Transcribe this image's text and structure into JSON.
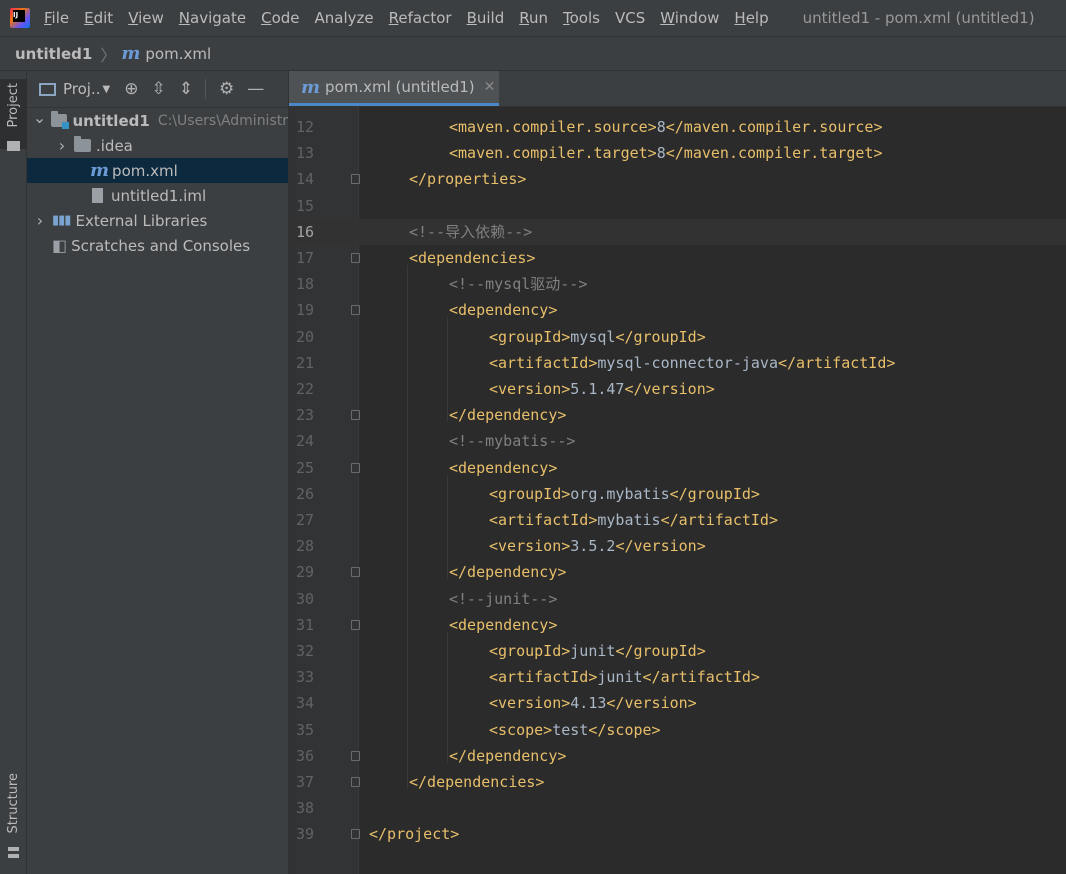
{
  "menubar": {
    "items": [
      {
        "label": "File",
        "u": "F",
        "rest": "ile"
      },
      {
        "label": "Edit",
        "u": "E",
        "rest": "dit"
      },
      {
        "label": "View",
        "u": "V",
        "rest": "iew"
      },
      {
        "label": "Navigate",
        "u": "N",
        "rest": "avigate"
      },
      {
        "label": "Code",
        "u": "C",
        "rest": "ode"
      },
      {
        "label": "Analyze",
        "u": "",
        "rest": "Analyze"
      },
      {
        "label": "Refactor",
        "u": "R",
        "rest": "efactor"
      },
      {
        "label": "Build",
        "u": "B",
        "rest": "uild"
      },
      {
        "label": "Run",
        "u": "R",
        "rest": "un"
      },
      {
        "label": "Tools",
        "u": "T",
        "rest": "ools"
      },
      {
        "label": "VCS",
        "u": "",
        "rest": "VCS"
      },
      {
        "label": "Window",
        "u": "W",
        "rest": "indow"
      },
      {
        "label": "Help",
        "u": "H",
        "rest": "elp"
      }
    ],
    "window_title": "untitled1 - pom.xml (untitled1)"
  },
  "navbar": {
    "project": "untitled1",
    "file": "pom.xml",
    "file_icon": "m"
  },
  "left_stripe": {
    "project_tab": "Project",
    "structure_tab": "Structure"
  },
  "project_panel": {
    "view_selector": "Proj..",
    "tree": [
      {
        "label": "untitled1",
        "path": "C:\\Users\\Administr",
        "level": 0,
        "arrow": "open",
        "icon": "module-folder",
        "bold": true
      },
      {
        "label": ".idea",
        "level": 1,
        "arrow": "closed",
        "icon": "folder"
      },
      {
        "label": "pom.xml",
        "level": 1,
        "arrow": "none",
        "icon": "maven",
        "selected": true
      },
      {
        "label": "untitled1.iml",
        "level": 1,
        "arrow": "none",
        "icon": "iml-file"
      },
      {
        "label": "External Libraries",
        "level": 0,
        "arrow": "closed",
        "icon": "libraries"
      },
      {
        "label": "Scratches and Consoles",
        "level": 0,
        "arrow": "none",
        "icon": "scratches"
      }
    ]
  },
  "editor": {
    "tab_label": "pom.xml (untitled1)",
    "current_line": 16,
    "lines": [
      {
        "n": "12",
        "indent": 2,
        "parts": [
          [
            "tag",
            "<maven.compiler.source>"
          ],
          [
            "txt",
            "8"
          ],
          [
            "tag",
            "</maven.compiler.source>"
          ]
        ]
      },
      {
        "n": "13",
        "indent": 2,
        "parts": [
          [
            "tag",
            "<maven.compiler.target>"
          ],
          [
            "txt",
            "8"
          ],
          [
            "tag",
            "</maven.compiler.target>"
          ]
        ]
      },
      {
        "n": "14",
        "indent": 1,
        "fold": true,
        "parts": [
          [
            "tag",
            "</properties>"
          ]
        ]
      },
      {
        "n": "15",
        "indent": 0,
        "parts": []
      },
      {
        "n": "16",
        "indent": 1,
        "parts": [
          [
            "cmt",
            "<!--导入依赖-->"
          ]
        ]
      },
      {
        "n": "17",
        "indent": 1,
        "fold": true,
        "parts": [
          [
            "tag",
            "<dependencies>"
          ]
        ]
      },
      {
        "n": "18",
        "indent": 2,
        "parts": [
          [
            "cmt",
            "<!--mysql驱动-->"
          ]
        ]
      },
      {
        "n": "19",
        "indent": 2,
        "fold": true,
        "parts": [
          [
            "tag",
            "<dependency>"
          ]
        ]
      },
      {
        "n": "20",
        "indent": 3,
        "parts": [
          [
            "tag",
            "<groupId>"
          ],
          [
            "txt",
            "mysql"
          ],
          [
            "tag",
            "</groupId>"
          ]
        ]
      },
      {
        "n": "21",
        "indent": 3,
        "parts": [
          [
            "tag",
            "<artifactId>"
          ],
          [
            "txt",
            "mysql-connector-java"
          ],
          [
            "tag",
            "</artifactId>"
          ]
        ]
      },
      {
        "n": "22",
        "indent": 3,
        "parts": [
          [
            "tag",
            "<version>"
          ],
          [
            "txt",
            "5.1.47"
          ],
          [
            "tag",
            "</version>"
          ]
        ]
      },
      {
        "n": "23",
        "indent": 2,
        "fold": true,
        "parts": [
          [
            "tag",
            "</dependency>"
          ]
        ]
      },
      {
        "n": "24",
        "indent": 2,
        "parts": [
          [
            "cmt",
            "<!--mybatis-->"
          ]
        ]
      },
      {
        "n": "25",
        "indent": 2,
        "fold": true,
        "parts": [
          [
            "tag",
            "<dependency>"
          ]
        ]
      },
      {
        "n": "26",
        "indent": 3,
        "parts": [
          [
            "tag",
            "<groupId>"
          ],
          [
            "txt",
            "org.mybatis"
          ],
          [
            "tag",
            "</groupId>"
          ]
        ]
      },
      {
        "n": "27",
        "indent": 3,
        "parts": [
          [
            "tag",
            "<artifactId>"
          ],
          [
            "txt",
            "mybatis"
          ],
          [
            "tag",
            "</artifactId>"
          ]
        ]
      },
      {
        "n": "28",
        "indent": 3,
        "parts": [
          [
            "tag",
            "<version>"
          ],
          [
            "txt",
            "3.5.2"
          ],
          [
            "tag",
            "</version>"
          ]
        ]
      },
      {
        "n": "29",
        "indent": 2,
        "fold": true,
        "parts": [
          [
            "tag",
            "</dependency>"
          ]
        ]
      },
      {
        "n": "30",
        "indent": 2,
        "parts": [
          [
            "cmt",
            "<!--junit-->"
          ]
        ]
      },
      {
        "n": "31",
        "indent": 2,
        "fold": true,
        "parts": [
          [
            "tag",
            "<dependency>"
          ]
        ]
      },
      {
        "n": "32",
        "indent": 3,
        "parts": [
          [
            "tag",
            "<groupId>"
          ],
          [
            "txt",
            "junit"
          ],
          [
            "tag",
            "</groupId>"
          ]
        ]
      },
      {
        "n": "33",
        "indent": 3,
        "parts": [
          [
            "tag",
            "<artifactId>"
          ],
          [
            "txt",
            "junit"
          ],
          [
            "tag",
            "</artifactId>"
          ]
        ]
      },
      {
        "n": "34",
        "indent": 3,
        "parts": [
          [
            "tag",
            "<version>"
          ],
          [
            "txt",
            "4.13"
          ],
          [
            "tag",
            "</version>"
          ]
        ]
      },
      {
        "n": "35",
        "indent": 3,
        "parts": [
          [
            "tag",
            "<scope>"
          ],
          [
            "txt",
            "test"
          ],
          [
            "tag",
            "</scope>"
          ]
        ]
      },
      {
        "n": "36",
        "indent": 2,
        "fold": true,
        "parts": [
          [
            "tag",
            "</dependency>"
          ]
        ]
      },
      {
        "n": "37",
        "indent": 1,
        "fold": true,
        "parts": [
          [
            "tag",
            "</dependencies>"
          ]
        ]
      },
      {
        "n": "38",
        "indent": 0,
        "parts": []
      },
      {
        "n": "39",
        "indent": 0,
        "fold": true,
        "parts": [
          [
            "tag",
            "</project>"
          ]
        ]
      }
    ]
  }
}
